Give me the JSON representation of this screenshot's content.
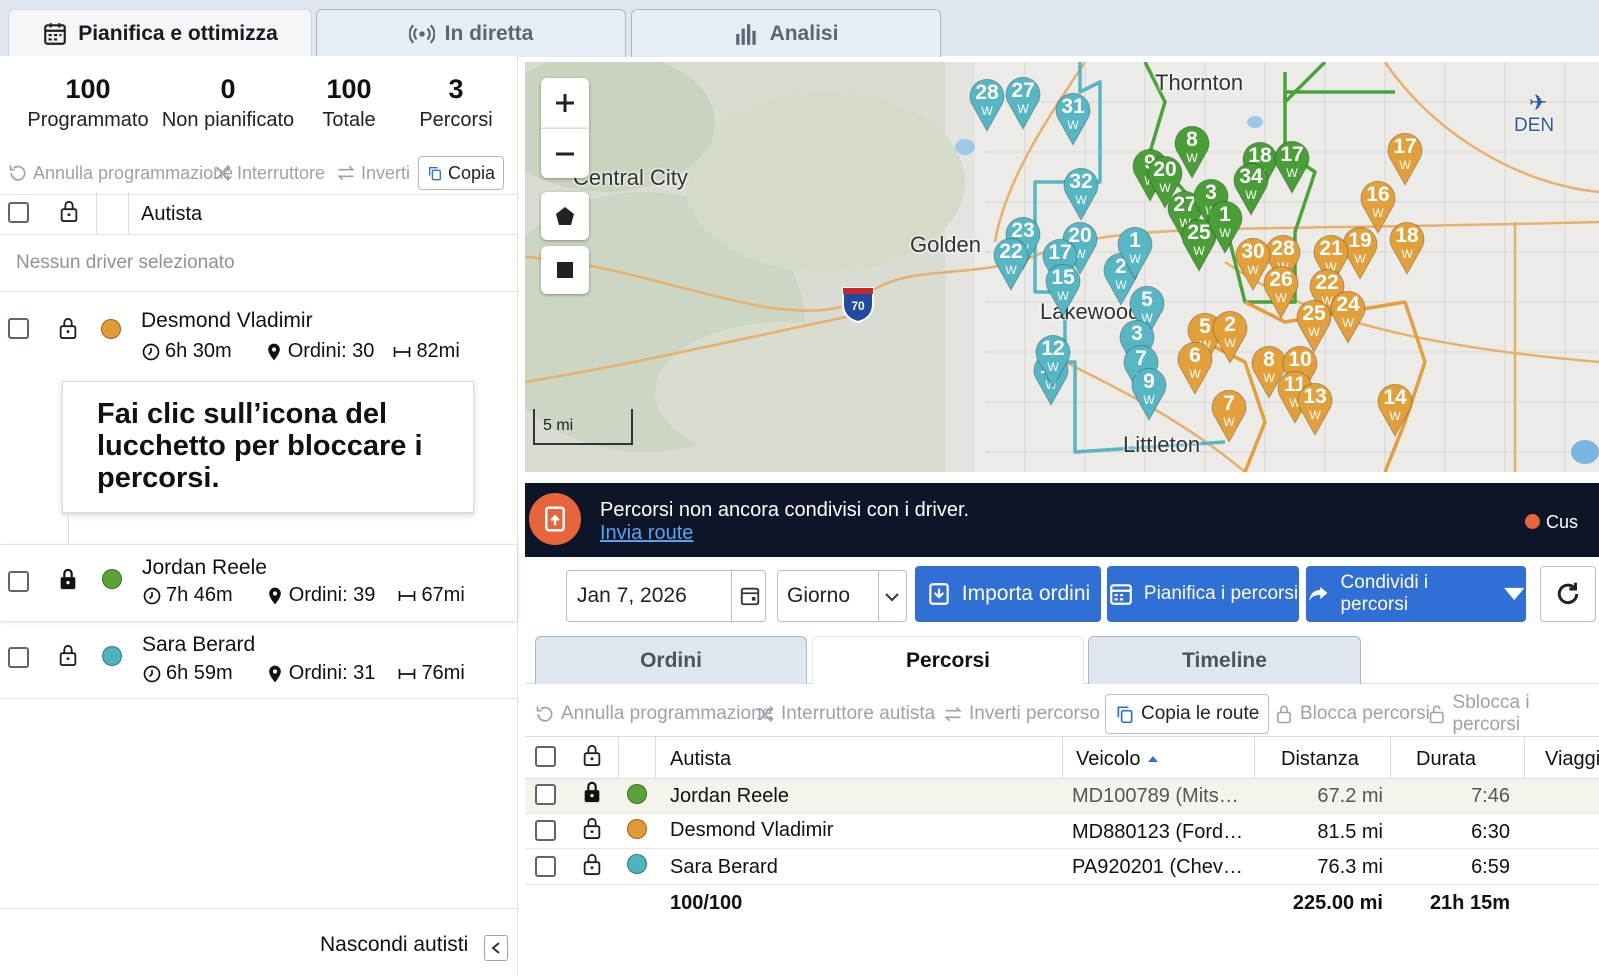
{
  "top_tabs": [
    {
      "label": "Pianifica e ottimizza",
      "icon": "calendar-icon",
      "active": true
    },
    {
      "label": "In diretta",
      "icon": "broadcast-icon",
      "active": false
    },
    {
      "label": "Analisi",
      "icon": "bar-chart-icon",
      "active": false
    }
  ],
  "summary": {
    "scheduled": {
      "value": "100",
      "label": "Programmato"
    },
    "unscheduled": {
      "value": "0",
      "label": "Non pianificato"
    },
    "total": {
      "value": "100",
      "label": "Totale"
    },
    "routes": {
      "value": "3",
      "label": "Percorsi"
    }
  },
  "left_toolbar": {
    "undo": "Annulla programmazione",
    "switch": "Interruttore",
    "reverse": "Inverti",
    "copy": "Copia"
  },
  "driver_header": {
    "label": "Autista",
    "empty_note": "Nessun driver selezionato"
  },
  "drivers": [
    {
      "name": "Desmond Vladimir",
      "time": "6h 30m",
      "orders": "Ordini: 30",
      "distance": "82mi",
      "color": "#e39a34",
      "locked": false
    },
    {
      "name": "Jordan Reele",
      "time": "7h 46m",
      "orders": "Ordini: 39",
      "distance": "67mi",
      "color": "#5aa339",
      "locked": true
    },
    {
      "name": "Sara Berard",
      "time": "6h 59m",
      "orders": "Ordini: 31",
      "distance": "76mi",
      "color": "#4fb3bf",
      "locked": false
    }
  ],
  "callout": "Fai clic sull’icona del lucchetto per bloccare i percorsi.",
  "hide_drivers": "Nascondi autisti",
  "map": {
    "places": [
      "Thornton",
      "Central City",
      "Golden",
      "Lakewood",
      "Littleton",
      "DEN"
    ],
    "highway": "70",
    "scale": "5 mi",
    "pins_teal": [
      "28",
      "27",
      "31",
      "32",
      "23",
      "22",
      "20",
      "17",
      "15",
      "2",
      "1",
      "5",
      "3",
      "7",
      "9",
      "11",
      "12"
    ],
    "pins_green": [
      "9",
      "8",
      "18",
      "17",
      "20",
      "27",
      "3",
      "34",
      "25",
      "1"
    ],
    "pins_orange": [
      "17",
      "16",
      "18",
      "19",
      "21",
      "28",
      "30",
      "26",
      "22",
      "25",
      "24",
      "5",
      "2",
      "6",
      "8",
      "10",
      "11",
      "13",
      "7",
      "14"
    ]
  },
  "banner": {
    "message": "Percorsi non ancora condivisi con i driver.",
    "link": "Invia route",
    "right_text": "Cus"
  },
  "controls": {
    "date": "Jan 7, 2026",
    "period": "Giorno",
    "import": "Importa ordini",
    "plan": "Pianifica i percorsi",
    "share": "Condividi i percorsi"
  },
  "sub_tabs": [
    {
      "label": "Ordini",
      "active": false
    },
    {
      "label": "Percorsi",
      "active": true
    },
    {
      "label": "Timeline",
      "active": false
    }
  ],
  "routes_toolbar": {
    "undo": "Annulla programmazione",
    "switch": "Interruttore autista",
    "reverse": "Inverti percorso",
    "copy": "Copia le route",
    "lock": "Blocca percorsi",
    "unlock": "Sblocca i percorsi"
  },
  "table": {
    "headers": [
      "Autista",
      "Veicolo",
      "Distanza",
      "Durata",
      "Viaggi"
    ],
    "rows": [
      {
        "driver": "Jordan Reele",
        "vehicle": "MD100789 (Mits…",
        "distance": "67.2 mi",
        "duration": "7:46",
        "color": "#5aa339",
        "locked": true
      },
      {
        "driver": "Desmond Vladimir",
        "vehicle": "MD880123 (Ford…",
        "distance": "81.5 mi",
        "duration": "6:30",
        "color": "#e39a34",
        "locked": false
      },
      {
        "driver": "Sara Berard",
        "vehicle": "PA920201 (Chev…",
        "distance": "76.3 mi",
        "duration": "6:59",
        "color": "#4fb3bf",
        "locked": false
      }
    ],
    "totals": {
      "count": "100/100",
      "distance": "225.00 mi",
      "duration": "21h 15m"
    }
  }
}
